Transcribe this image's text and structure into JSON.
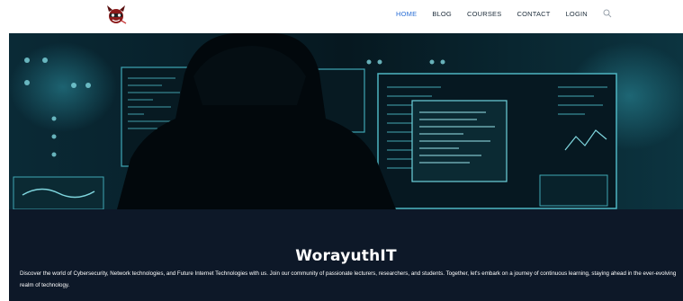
{
  "header": {
    "logo_icon": "devil-mascot-icon",
    "nav": {
      "home": "HOME",
      "blog": "BLOG",
      "courses": "COURSES",
      "contact": "CONTACT",
      "login": "LOGIN"
    },
    "search_icon": "search-icon",
    "active_color": "#2a6fd6"
  },
  "hero": {
    "image": "hooded-hacker-at-monitors"
  },
  "intro": {
    "title": "WorayuthIT",
    "description": "Discover the world of Cybersecurity, Network technologies, and Future Internet Technologies with us. Join our community of passionate lecturers, researchers, and students. Together, let's embark on a journey of continuous learning, staying ahead in the ever-evolving realm of technology.",
    "background": "#0d1828"
  }
}
